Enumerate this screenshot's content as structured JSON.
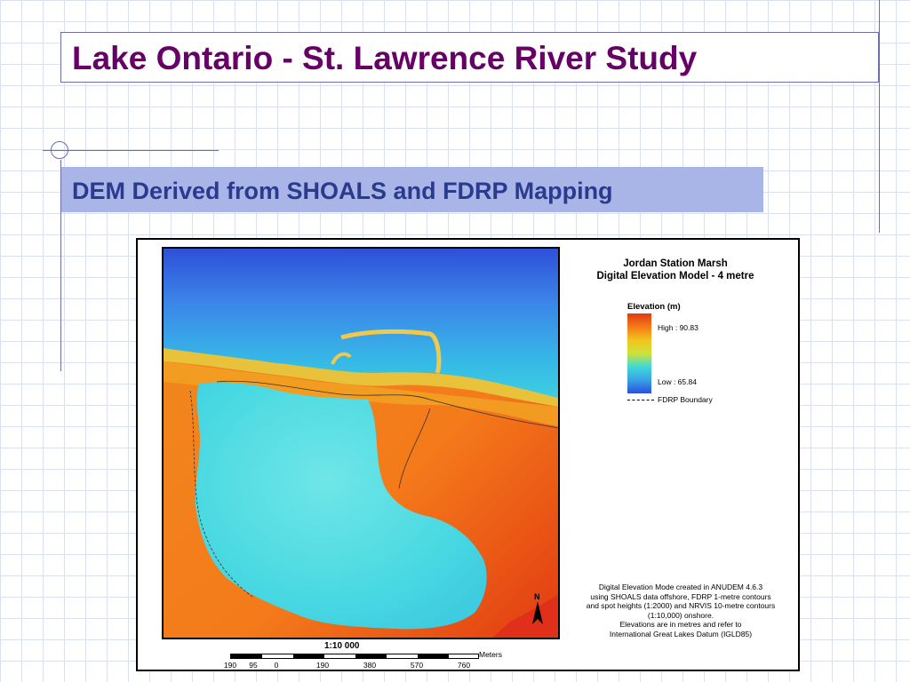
{
  "slide": {
    "title": "Lake Ontario - St. Lawrence River Study",
    "subtitle": "DEM Derived from SHOALS and FDRP Mapping",
    "colors": {
      "title": "#660066",
      "subtitle_text": "#2a3b8f",
      "subtitle_bg": "#a9b5e6",
      "grid": "#d9dff0"
    }
  },
  "map": {
    "title_line1": "Jordan Station Marsh",
    "title_line2": "Digital Elevation Model - 4 metre",
    "legend": {
      "title": "Elevation (m)",
      "high": "High : 90.83",
      "low": "Low : 65.84",
      "boundary": "FDRP Boundary"
    },
    "notes": [
      "Digital Elevation Mode created in ANUDEM 4.6.3",
      "using SHOALS data offshore,  FDRP 1-metre contours",
      "and spot heights (1:2000) and  NRVIS 10-metre contours",
      "(1:10,000) onshore.",
      "Elevations are in metres and refer to",
      "International Great Lakes Datum (IGLD85)"
    ],
    "north": "N",
    "scale": {
      "ratio": "1:10 000",
      "units": "Meters",
      "labels": [
        "190",
        "95",
        "0",
        "190",
        "380",
        "570",
        "760"
      ]
    }
  }
}
